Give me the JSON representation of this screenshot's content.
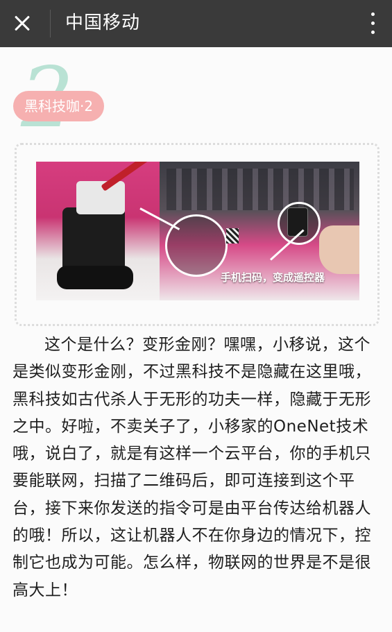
{
  "topbar": {
    "title": "中国移动"
  },
  "icons": {
    "close": "close-icon",
    "more": "more-vertical-icon"
  },
  "section": {
    "number": "2",
    "badge_label": "黑科技咖·2"
  },
  "image": {
    "caption": "手机扫码，变成遥控器"
  },
  "article": {
    "text": "这个是什么？变形金刚？嘿嘿，小移说，这个是类似变形金刚，不过黑科技不是隐藏在这里哦，黑科技如古代杀人于无形的功夫一样，隐藏于无形之中。好啦，不卖关子了，小移家的OneNet技术哦，说白了，就是有这样一个云平台，你的手机只要能联网，扫描了二维码后，即可连接到这个平台，接下来你发送的指令可是由平台传达给机器人的哦！所以，这让机器人不在你身边的情况下，控制它也成为可能。怎么样，物联网的世界是不是很高大上！"
  },
  "colors": {
    "topbar": "#3a3a3a",
    "badge": "#f6b0b0",
    "badge_number": "#b9e2d4"
  }
}
